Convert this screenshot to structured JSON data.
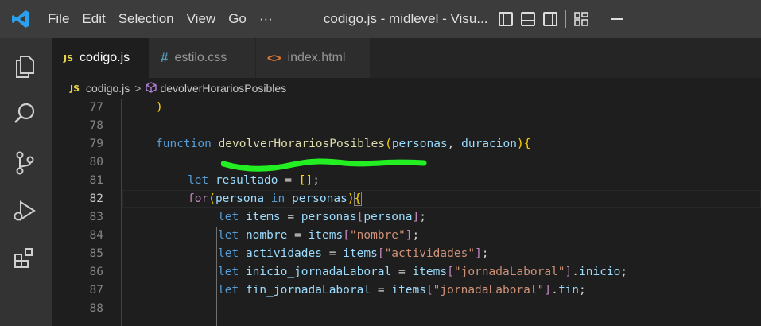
{
  "titlebar": {
    "menu": [
      "File",
      "Edit",
      "Selection",
      "View",
      "Go",
      "···"
    ],
    "title": "codigo.js - midlevel - Visu..."
  },
  "tabs": [
    {
      "icon": "JS",
      "label": "codigo.js",
      "active": true,
      "close": "✕"
    },
    {
      "icon": "#",
      "label": "estilo.css",
      "active": false
    },
    {
      "icon": "<>",
      "label": "index.html",
      "active": false
    }
  ],
  "breadcrumb": {
    "icon": "JS",
    "file": "codigo.js",
    "separator": ">",
    "symbol": "devolverHorariosPosibles"
  },
  "editor": {
    "current_line": "82",
    "lines": [
      {
        "n": "77",
        "code": ")"
      },
      {
        "n": "78",
        "code": ""
      },
      {
        "n": "79",
        "code": "function devolverHorariosPosibles(personas, duracion){"
      },
      {
        "n": "80",
        "code": ""
      },
      {
        "n": "81",
        "code": "let resultado = [];"
      },
      {
        "n": "82",
        "code": "for(persona in personas){"
      },
      {
        "n": "83",
        "code": "let items = personas[persona];"
      },
      {
        "n": "84",
        "code": "let nombre = items[\"nombre\"];"
      },
      {
        "n": "85",
        "code": "let actividades = items[\"actividades\"];"
      },
      {
        "n": "86",
        "code": "let inicio_jornadaLaboral = items[\"jornadaLaboral\"].inicio;"
      },
      {
        "n": "87",
        "code": "let fin_jornadaLaboral = items[\"jornadaLaboral\"].fin;"
      },
      {
        "n": "88",
        "code": ""
      }
    ]
  },
  "colors": {
    "annotation": "#22ee22",
    "keyword": "#569cd6",
    "function": "#dcdcaa",
    "param": "#9cdcfe",
    "string": "#ce9178",
    "control": "#c586c0"
  }
}
